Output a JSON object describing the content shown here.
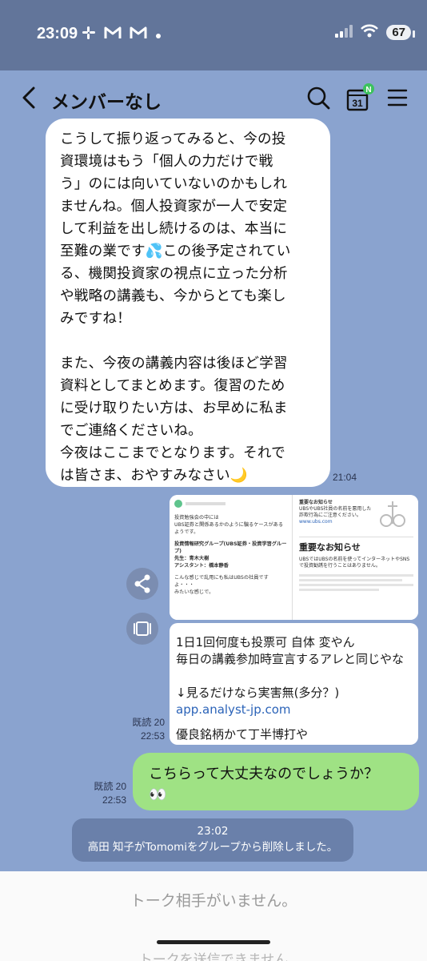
{
  "status": {
    "time": "23:09",
    "battery": "67",
    "icons_left": [
      "slack-icon",
      "gmail-icon",
      "gmail-icon",
      "dot"
    ]
  },
  "header": {
    "title": "メンバーなし",
    "calendar_day": "31",
    "badge": "N"
  },
  "messages": {
    "incoming_text": "こうして振り返ってみると、今の投\n資環境はもう「個人の力だけで戦\nう」のには向いていないのかもしれ\nませんね。個人投資家が一人で安定\nして利益を出し続けるのは、本当に\n至難の業です💦この後予定されてい\nる、機関投資家の視点に立った分析\nや戦略の講義も、今からとても楽し\nみですね！\n\nまた、今夜の講義内容は後ほど学習\n資料としてまとめます。復習のため\nに受け取りたい方は、お早めに私ま\nでご連絡くださいね。\n今夜はここまでとなります。それで\nは皆さま、おやすみなさい🌙",
    "incoming_time": "21:04",
    "image_left": {
      "line1": "投資勉強会の中には",
      "line2": "UBS証券と関係あるかのように騙るケースがあるようです。",
      "line3": "投資情報研究グループ(UBS証券・投資学習グループ)",
      "line4": "先生：青木大樹",
      "line5": "アシスタント：橋本静香",
      "line6": "こんな感じで乱用にも私はUBSの社員ですよ・・・",
      "line7": "みたいな感じで。"
    },
    "image_right": {
      "heading_small": "重要なお知らせ",
      "body_small": "UBSやUBS社員の名前を悪用した詐欺行為にご注意ください。",
      "url": "www.ubs.com",
      "heading_big": "重要なお知らせ",
      "body": "UBSではUBSの名前を使ってインターネットやSNSで投資勧誘を行うことはありません。"
    },
    "link_card": {
      "line1": "1日1回何度も投票可 自体 変やん",
      "line2": "毎日の講義参加時宣言するアレと同じやな",
      "line3": "↓見るだけなら実害無(多分？)",
      "link": "app.analyst-jp.com",
      "line4": "優良銘柄かて丁半博打や"
    },
    "read1": "既読 20",
    "time1": "22:53",
    "outgoing_text": "こちらって大丈夫なのでしょうか？\n👀",
    "read2": "既読 20",
    "time2": "22:53",
    "system_time": "23:02",
    "system_text": "高田 知子がTomomiをグループから削除しました。"
  },
  "footer": {
    "no_member": "トーク相手がいません。",
    "cutoff": "トークを送信できません"
  }
}
